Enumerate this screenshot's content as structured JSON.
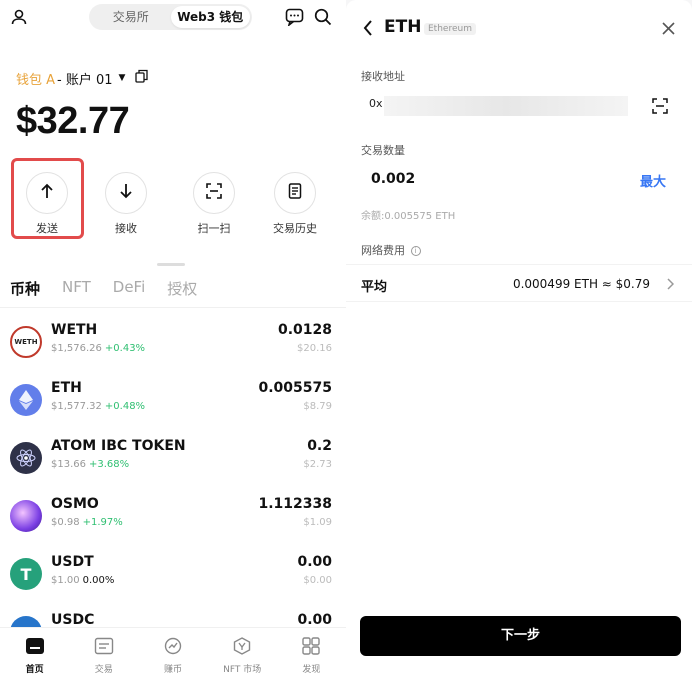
{
  "left": {
    "segments": [
      {
        "label": "交易所",
        "active": false
      },
      {
        "label": "Web3 钱包",
        "active": true
      }
    ],
    "wallet_name": "钱包 A",
    "account": "- 账户 01",
    "balance": "$32.77",
    "actions": [
      {
        "label": "发送",
        "icon": "arrow-up-icon"
      },
      {
        "label": "接收",
        "icon": "arrow-down-icon"
      },
      {
        "label": "扫一扫",
        "icon": "scan-icon"
      },
      {
        "label": "交易历史",
        "icon": "history-icon"
      }
    ],
    "asset_tabs": [
      "币种",
      "NFT",
      "DeFi",
      "授权"
    ],
    "tokens": [
      {
        "name": "WETH",
        "price": "$1,576.26",
        "change": "+0.43%",
        "qty": "0.0128",
        "usd": "$20.16",
        "logo_text": "WETH",
        "color": "#c0392b"
      },
      {
        "name": "ETH",
        "price": "$1,577.32",
        "change": "+0.48%",
        "qty": "0.005575",
        "usd": "$8.79",
        "logo_text": "",
        "color": "#627eea"
      },
      {
        "name": "ATOM IBC TOKEN",
        "price": "$13.66",
        "change": "+3.68%",
        "qty": "0.2",
        "usd": "$2.73",
        "logo_text": "",
        "color": "#2e3148"
      },
      {
        "name": "OSMO",
        "price": "$0.98",
        "change": "+1.97%",
        "qty": "1.112338",
        "usd": "$1.09",
        "logo_text": "",
        "color": "#7b3fe4"
      },
      {
        "name": "USDT",
        "price": "$1.00",
        "change": "0.00%",
        "qty": "0.00",
        "usd": "$0.00",
        "logo_text": "T",
        "color": "#26a17b"
      },
      {
        "name": "USDC",
        "price": "",
        "change": "",
        "qty": "0.00",
        "usd": "",
        "logo_text": "",
        "color": "#2775ca"
      }
    ],
    "nav": [
      {
        "label": "首页",
        "icon": "home-icon",
        "active": true
      },
      {
        "label": "交易",
        "icon": "trade-icon",
        "active": false
      },
      {
        "label": "赚币",
        "icon": "earn-icon",
        "active": false
      },
      {
        "label": "NFT 市场",
        "icon": "nft-market-icon",
        "active": false
      },
      {
        "label": "发现",
        "icon": "discover-icon",
        "active": false
      }
    ]
  },
  "right": {
    "title": "ETH",
    "subtitle": "Ethereum",
    "address_label": "接收地址",
    "address_value": "0x",
    "amount_label": "交易数量",
    "amount_value": "0.002",
    "max_label": "最大",
    "balance_hint": "余额:0.005575 ETH",
    "fee_label": "网络费用",
    "fee_tier": "平均",
    "fee_value": "0.000499 ETH ≈ $0.79",
    "next_label": "下一步"
  }
}
